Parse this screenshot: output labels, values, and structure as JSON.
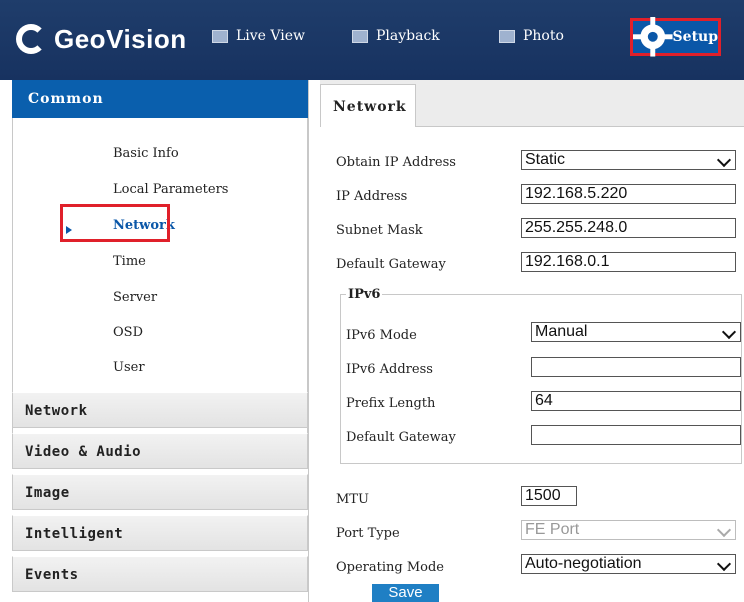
{
  "header": {
    "brand": "GeoVision",
    "nav": [
      {
        "label": "Live View",
        "icon": "monitor-icon"
      },
      {
        "label": "Playback",
        "icon": "film-icon"
      },
      {
        "label": "Photo",
        "icon": "photo-icon"
      },
      {
        "label": "Setup",
        "icon": "gear-icon"
      }
    ],
    "colors": {
      "bar": "#1d3a66",
      "active": "#0a57a8",
      "highlight": "#e0202a"
    }
  },
  "sidebar": {
    "common": "Common",
    "items": [
      "Basic Info",
      "Local Parameters",
      "Network",
      "Time",
      "Server",
      "OSD",
      "User"
    ],
    "active_item": "Network",
    "categories": [
      "Network",
      "Video & Audio",
      "Image",
      "Intelligent",
      "Events"
    ]
  },
  "main": {
    "tab": "Network",
    "obtain_ip": {
      "label": "Obtain IP Address",
      "value": "Static"
    },
    "ip_address": {
      "label": "IP Address",
      "value": "192.168.5.220"
    },
    "subnet_mask": {
      "label": "Subnet Mask",
      "value": "255.255.248.0"
    },
    "default_gateway": {
      "label": "Default Gateway",
      "value": "192.168.0.1"
    },
    "ipv6": {
      "legend": "IPv6",
      "mode": {
        "label": "IPv6 Mode",
        "value": "Manual"
      },
      "address": {
        "label": "IPv6 Address",
        "value": ""
      },
      "prefix": {
        "label": "Prefix Length",
        "value": "64"
      },
      "gateway": {
        "label": "Default Gateway",
        "value": ""
      }
    },
    "mtu": {
      "label": "MTU",
      "value": "1500"
    },
    "port_type": {
      "label": "Port Type",
      "value": "FE Port"
    },
    "operating_mode": {
      "label": "Operating Mode",
      "value": "Auto-negotiation"
    },
    "save_label": "Save"
  }
}
